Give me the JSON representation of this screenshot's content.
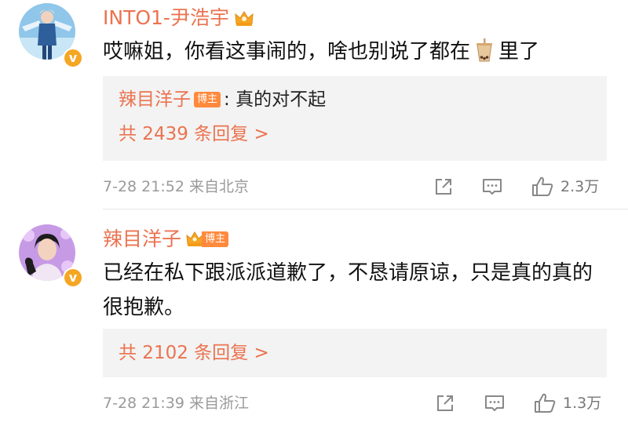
{
  "colors": {
    "username": "#eb7350",
    "reply_bg": "#f3f3f3",
    "meta_gray": "#9a9a9a",
    "badge_orange": "#f5a623",
    "bozhu_tag": "#ff8a3d"
  },
  "comments": [
    {
      "username": "INTO1-尹浩宇",
      "verified_badge": "v",
      "badge_icon": "crown-icon",
      "text_before_emoji": "哎嘛姐，你看这事闹的，啥也别说了都在",
      "emoji_icon": "bubble-tea-icon",
      "text_after_emoji": "里了",
      "reply_preview": {
        "author": "辣目洋子",
        "tag": "博主",
        "text": ": 真的对不起"
      },
      "more_replies": "共 2439 条回复 >",
      "timestamp": "7-28 21:52  来自北京",
      "like_count": "2.3万"
    },
    {
      "username": "辣目洋子",
      "verified_badge": "v",
      "tag": "博主",
      "text": "已经在私下跟派派道歉了，不恳请原谅，只是真的真的很抱歉。",
      "more_replies": "共 2102 条回复 >",
      "timestamp": "7-28 21:39  来自浙江",
      "like_count": "1.3万"
    }
  ]
}
